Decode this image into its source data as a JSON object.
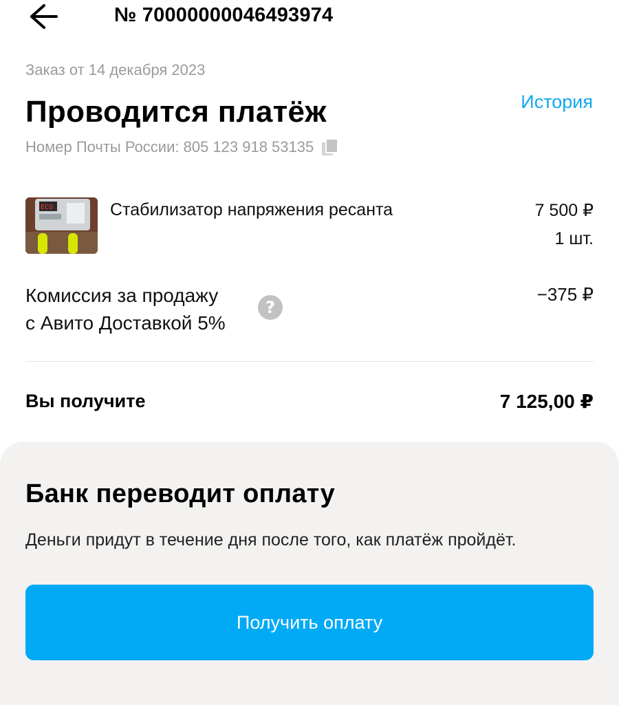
{
  "header": {
    "back_icon": "arrow-left-icon",
    "order_number": "№ 70000000046493974"
  },
  "order": {
    "date": "Заказ от 14 декабря 2023",
    "status_title": "Проводится платёж",
    "history_link": "История",
    "tracking": "Номер Почты России: 805 123 918 53135",
    "copy_icon": "copy-icon"
  },
  "product": {
    "title": "Стабилизатор напряжения ресанта",
    "price": "7 500 ₽",
    "quantity": "1 шт."
  },
  "commission": {
    "line1": "Комиссия за продажу",
    "line2": "с Авито Доставкой 5%",
    "amount": "−375 ₽",
    "help_icon": "question-circle-icon"
  },
  "summary": {
    "label": "Вы получите",
    "amount": "7 125,00 ₽"
  },
  "bank": {
    "title": "Банк переводит оплату",
    "description": "Деньги придут в течение дня после того, как платёж пройдёт.",
    "button_label": "Получить оплату"
  },
  "colors": {
    "accent": "#02aaf6",
    "link": "#11a7ee",
    "muted_text": "#9a9a9a",
    "card_background": "#f3f2f1"
  }
}
